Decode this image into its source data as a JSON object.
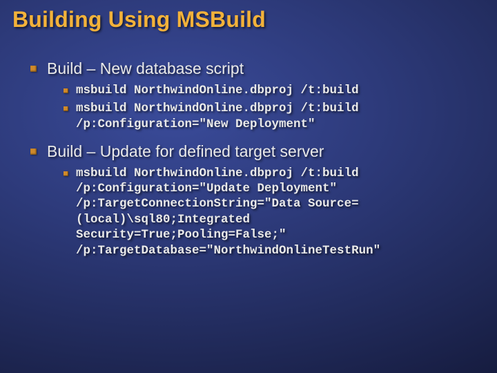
{
  "title": "Building Using MSBuild",
  "sections": [
    {
      "heading": "Build – New database script",
      "items": [
        "msbuild NorthwindOnline.dbproj /t:build",
        "msbuild NorthwindOnline.dbproj /t:build /p:Configuration=\"New Deployment\""
      ]
    },
    {
      "heading": "Build – Update for defined target server",
      "items": [
        "msbuild NorthwindOnline.dbproj /t:build /p:Configuration=\"Update Deployment\" /p:TargetConnectionString=\"Data Source=(local)\\sql80;Integrated Security=True;Pooling=False;\" /p:TargetDatabase=\"NorthwindOnlineTestRun\""
      ]
    }
  ]
}
